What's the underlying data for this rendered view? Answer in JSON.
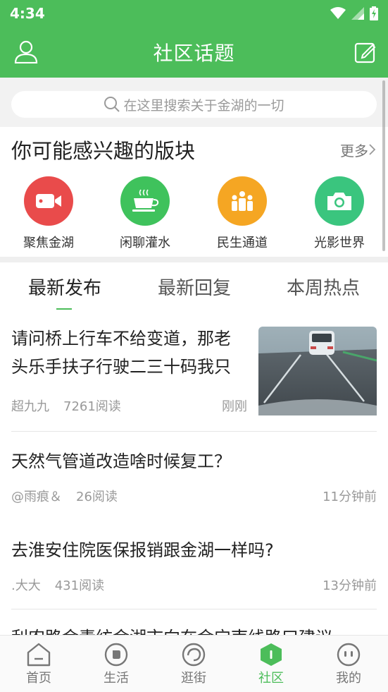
{
  "status_bar": {
    "time": "4:34",
    "icons": [
      "wifi-icon",
      "signal-icon",
      "battery-charging-icon"
    ]
  },
  "app_bar": {
    "title": "社区话题",
    "left_icon": "user-profile-icon",
    "right_icon": "compose-icon"
  },
  "search": {
    "placeholder": "在这里搜索关于金湖的一切"
  },
  "interest_section": {
    "title": "你可能感兴趣的版块",
    "more_label": "更多",
    "categories": [
      {
        "label": "聚焦金湖",
        "icon": "video-camera-icon",
        "color": "#e94b4b"
      },
      {
        "label": "闲聊灌水",
        "icon": "coffee-cup-icon",
        "color": "#3fc25c"
      },
      {
        "label": "民生通道",
        "icon": "people-group-icon",
        "color": "#f5a623"
      },
      {
        "label": "光影世界",
        "icon": "camera-icon",
        "color": "#3ac57e"
      }
    ]
  },
  "tabs": [
    {
      "label": "最新发布",
      "active": true
    },
    {
      "label": "最新回复",
      "active": false
    },
    {
      "label": "本周热点",
      "active": false
    }
  ],
  "posts": [
    {
      "title": "请问桥上行车不给变道，那老头乐手扶子行驶二三十码我只能跟着？",
      "author": "超九九",
      "views": "7261阅读",
      "time": "刚刚",
      "has_image": true
    },
    {
      "title": "天然气管道改造啥时候复工？",
      "author": "@雨痕＆",
      "views": "26阅读",
      "time": "11分钟前",
      "has_image": false
    },
    {
      "title": "去淮安住院医保报销跟金湖一样吗?",
      "author": ".大大",
      "views": "431阅读",
      "time": "13分钟前",
      "has_image": false
    },
    {
      "title": "利农路金素纺金湖市向在金宁南线路口建议",
      "author": "",
      "views": "",
      "time": "",
      "has_image": false
    }
  ],
  "bottom_nav": [
    {
      "label": "首页",
      "icon": "home-icon",
      "active": false
    },
    {
      "label": "生活",
      "icon": "life-icon",
      "active": false
    },
    {
      "label": "逛街",
      "icon": "shopping-icon",
      "active": false
    },
    {
      "label": "社区",
      "icon": "community-icon",
      "active": true
    },
    {
      "label": "我的",
      "icon": "profile-face-icon",
      "active": false
    }
  ],
  "colors": {
    "brand_green": "#4cbd5a",
    "text_primary": "#222222",
    "text_secondary": "#999999"
  }
}
